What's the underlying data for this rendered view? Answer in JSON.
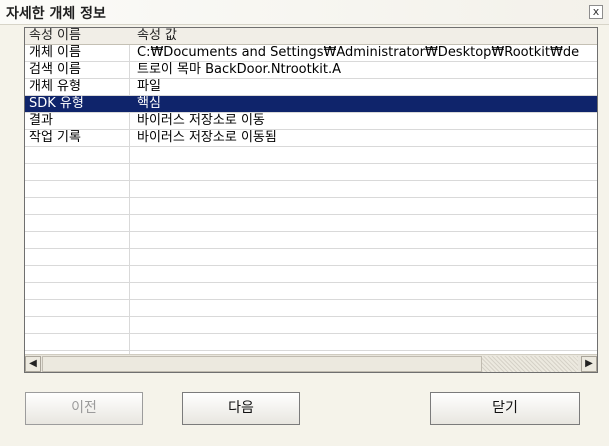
{
  "window": {
    "title": "자세한 개체 정보",
    "close_label": "x"
  },
  "table": {
    "headers": [
      "속성 이름",
      "속성 값"
    ],
    "rows": [
      {
        "name": "개체 이름",
        "value": "C:₩Documents and Settings₩Administrator₩Desktop₩Rootkit₩de"
      },
      {
        "name": "검색 이름",
        "value": "트로이 목마 BackDoor.Ntrootkit.A"
      },
      {
        "name": "개체 유형",
        "value": "파일"
      },
      {
        "name": "SDK 유형",
        "value": "핵심",
        "selected": true
      },
      {
        "name": "결과",
        "value": "바이러스 저장소로 이동"
      },
      {
        "name": "작업 기록",
        "value": "바이러스 저장소로 이동됨"
      }
    ]
  },
  "buttons": {
    "prev": "이전",
    "next": "다음",
    "close": "닫기"
  }
}
